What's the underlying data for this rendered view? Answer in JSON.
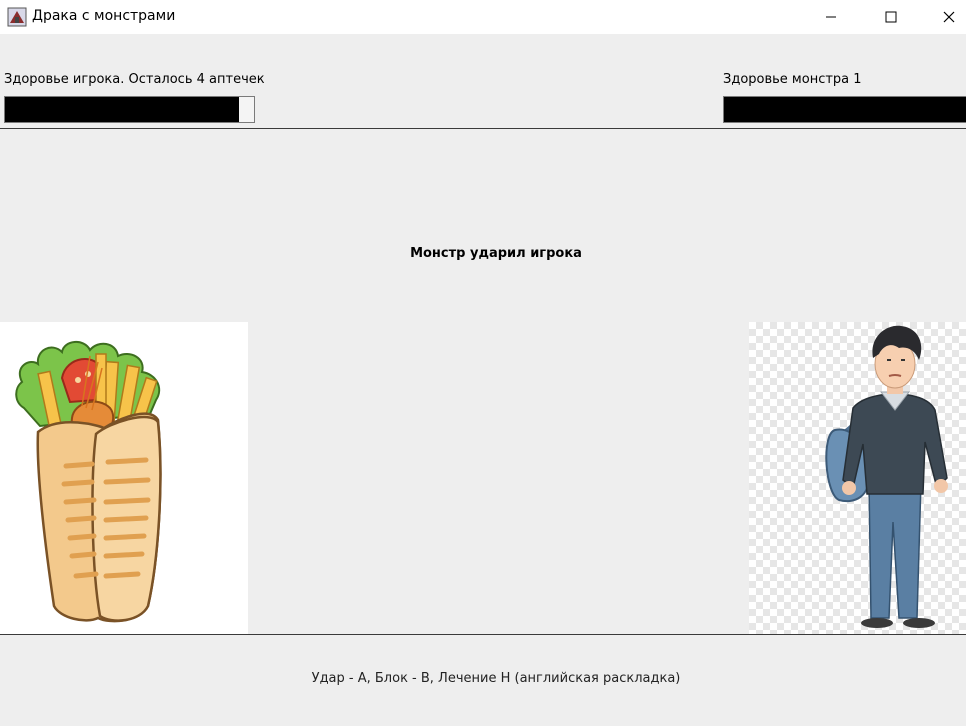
{
  "window": {
    "title": "Драка с монстрами",
    "app_icon": "game-icon",
    "controls": [
      "minimize-icon",
      "maximize-icon",
      "close-icon"
    ]
  },
  "player": {
    "health_label": "Здоровье игрока. Осталось 4 аптечек",
    "health_fraction": 0.94,
    "image": "player-character-image"
  },
  "monster": {
    "health_label": "Здоровье монстра 1",
    "health_fraction": 1.0,
    "image": "shawarma-monster-image"
  },
  "status_message": "Монстр ударил игрока",
  "controls_hint": "Удар - A, Блок - B, Лечение H (английская раскладка)",
  "colors": {
    "bar_fill": "#000000",
    "background": "#eeeeee"
  }
}
